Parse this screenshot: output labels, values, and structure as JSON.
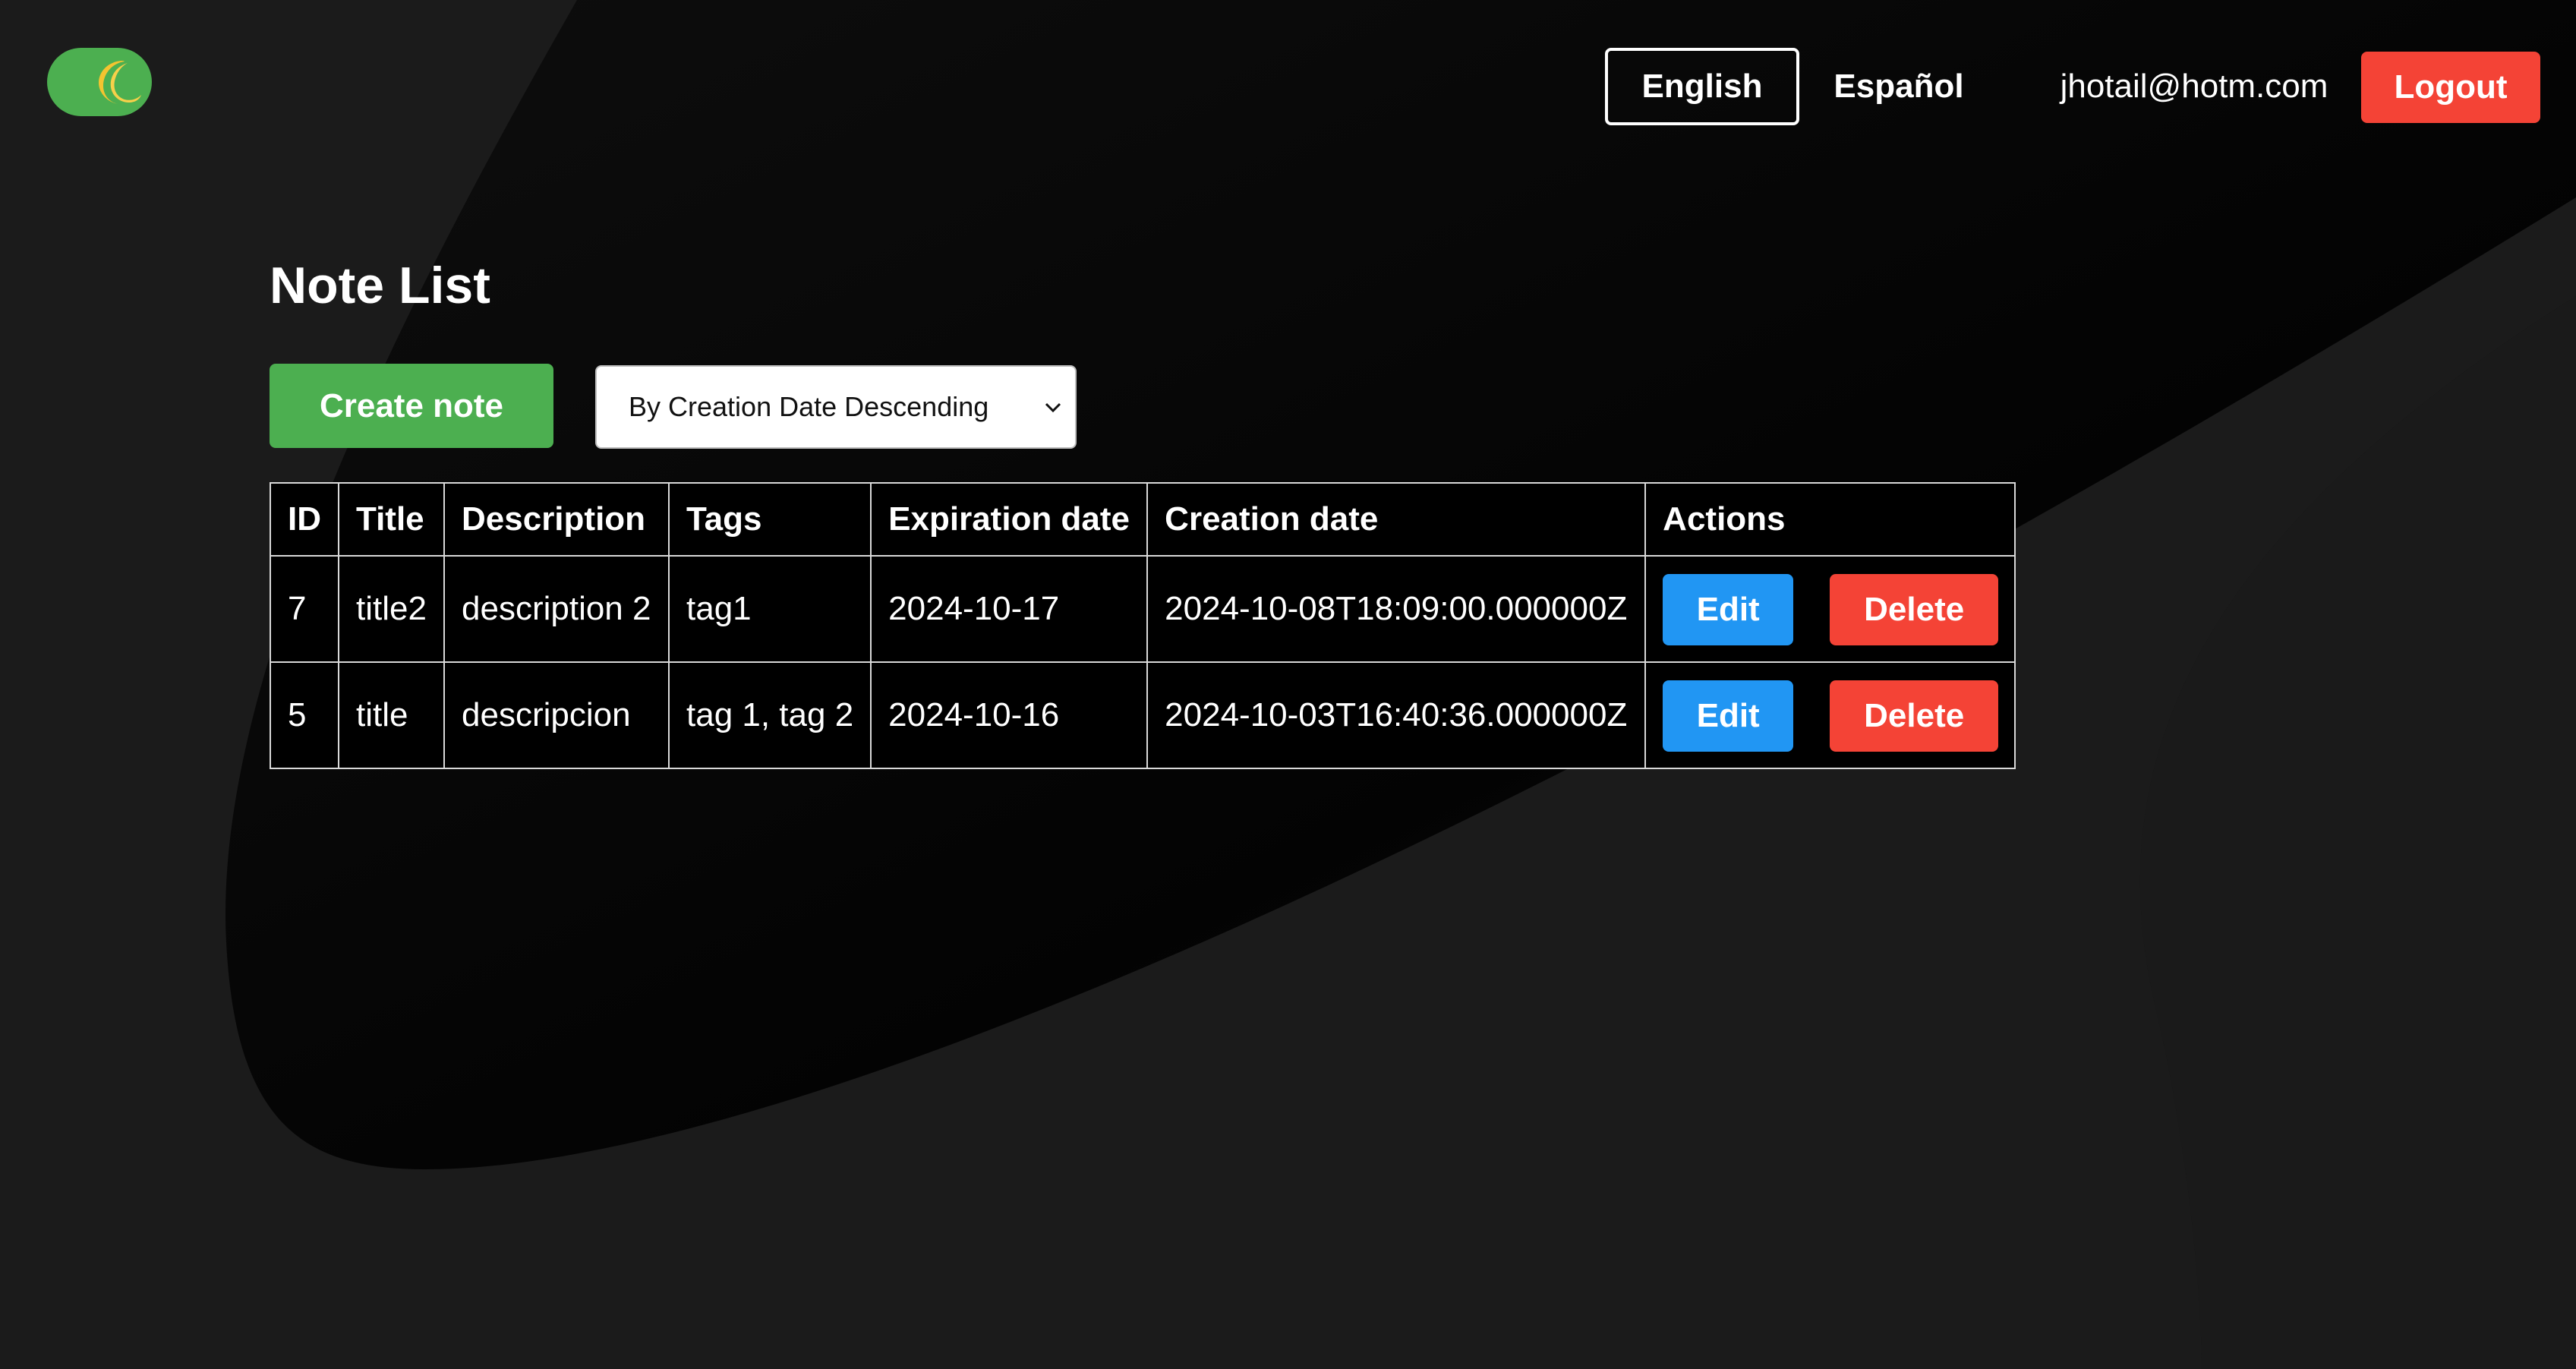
{
  "colors": {
    "background": "#1b1b1b",
    "accent_green": "#4caf50",
    "accent_blue": "#2196f3",
    "accent_red": "#f44336",
    "table_bg": "#000000"
  },
  "header": {
    "theme_toggle_icon": "crescent-moon-icon",
    "languages": [
      "English",
      "Español"
    ],
    "active_language": "English",
    "user_email": "jhotail@hotm.com",
    "logout_label": "Logout"
  },
  "page": {
    "title": "Note List"
  },
  "toolbar": {
    "create_label": "Create note",
    "sort_selected": "By Creation Date Descending"
  },
  "table": {
    "headers": [
      "ID",
      "Title",
      "Description",
      "Tags",
      "Expiration date",
      "Creation date",
      "Actions"
    ],
    "rows": [
      {
        "id": "7",
        "title": "title2",
        "description": "description 2",
        "tags": "tag1",
        "expiration_date": "2024-10-17",
        "creation_date": "2024-10-08T18:09:00.000000Z",
        "edit_label": "Edit",
        "delete_label": "Delete"
      },
      {
        "id": "5",
        "title": "title",
        "description": "descripcion",
        "tags": "tag 1, tag 2",
        "expiration_date": "2024-10-16",
        "creation_date": "2024-10-03T16:40:36.000000Z",
        "edit_label": "Edit",
        "delete_label": "Delete"
      }
    ]
  }
}
